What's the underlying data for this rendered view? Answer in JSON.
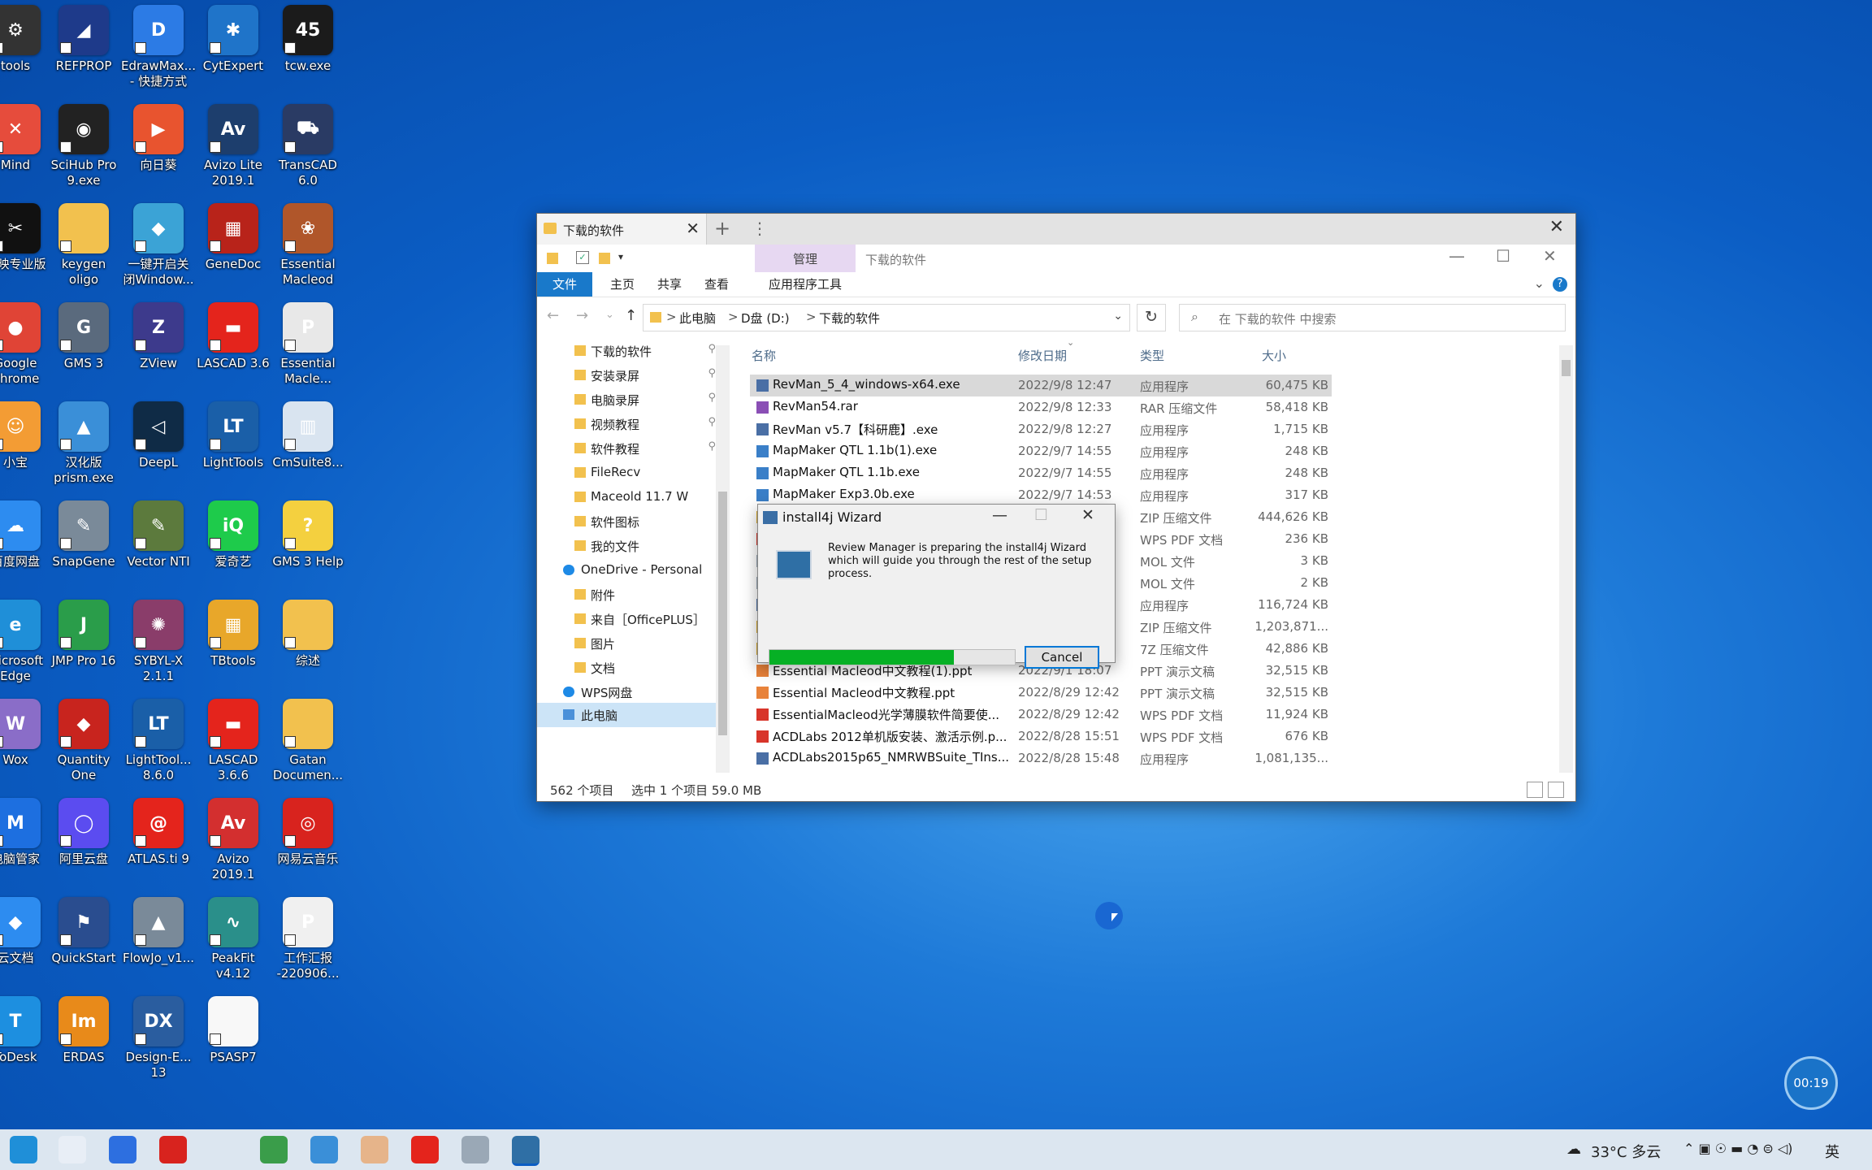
{
  "desktop": {
    "icons": [
      {
        "label": "tools",
        "col": 0,
        "row": 0,
        "color": "#333333",
        "glyph": "⚙"
      },
      {
        "label": "REFPROP",
        "col": 1,
        "row": 0,
        "color": "#1e3a8a",
        "glyph": "◢"
      },
      {
        "label": "EdrawMax...\n- 快捷方式",
        "col": 2,
        "row": 0,
        "color": "#2c7be5",
        "glyph": "D"
      },
      {
        "label": "CytExpert",
        "col": 3,
        "row": 0,
        "color": "#1f74c9",
        "glyph": "✱"
      },
      {
        "label": "tcw.exe",
        "col": 4,
        "row": 0,
        "color": "#1b1b1b",
        "glyph": "45"
      },
      {
        "label": "Mind",
        "col": 0,
        "row": 1,
        "color": "#e64c3c",
        "glyph": "✕"
      },
      {
        "label": "SciHub Pro\n9.exe",
        "col": 1,
        "row": 1,
        "color": "#222222",
        "glyph": "◉"
      },
      {
        "label": "向日葵",
        "col": 2,
        "row": 1,
        "color": "#e8542f",
        "glyph": "▶"
      },
      {
        "label": "Avizo Lite\n2019.1",
        "col": 3,
        "row": 1,
        "color": "#1d3e6d",
        "glyph": "Av"
      },
      {
        "label": "TransCAD\n6.0",
        "col": 4,
        "row": 1,
        "color": "#2a3b64",
        "glyph": "⛟"
      },
      {
        "label": "剪映专业版",
        "col": 0,
        "row": 2,
        "color": "#111111",
        "glyph": "✂"
      },
      {
        "label": "keygen\noligo",
        "col": 1,
        "row": 2,
        "color": "#f2c14e",
        "glyph": ""
      },
      {
        "label": "一键开启关\n闭Window...",
        "col": 2,
        "row": 2,
        "color": "#3ba3d6",
        "glyph": "◆"
      },
      {
        "label": "GeneDoc",
        "col": 3,
        "row": 2,
        "color": "#b8231a",
        "glyph": "▦"
      },
      {
        "label": "Essential\nMacleod",
        "col": 4,
        "row": 2,
        "color": "#b0562a",
        "glyph": "❀"
      },
      {
        "label": "Google\nChrome",
        "col": 0,
        "row": 3,
        "color": "#e04436",
        "glyph": "●"
      },
      {
        "label": "GMS 3",
        "col": 1,
        "row": 3,
        "color": "#5a6a7d",
        "glyph": "G"
      },
      {
        "label": "ZView",
        "col": 2,
        "row": 3,
        "color": "#3d3a8c",
        "glyph": "Z"
      },
      {
        "label": "LASCAD 3.6",
        "col": 3,
        "row": 3,
        "color": "#e4241c",
        "glyph": "▬"
      },
      {
        "label": "Essential\nMacle...",
        "col": 4,
        "row": 3,
        "color": "#e8e8e8",
        "glyph": "P"
      },
      {
        "label": "小宝",
        "col": 0,
        "row": 4,
        "color": "#f39c34",
        "glyph": "☺"
      },
      {
        "label": "汉化版\nprism.exe",
        "col": 1,
        "row": 4,
        "color": "#3a8fd8",
        "glyph": "▲"
      },
      {
        "label": "DeepL",
        "col": 2,
        "row": 4,
        "color": "#0f2b46",
        "glyph": "◁"
      },
      {
        "label": "LightTools",
        "col": 3,
        "row": 4,
        "color": "#1a5fa8",
        "glyph": "LT"
      },
      {
        "label": "CmSuite8...",
        "col": 4,
        "row": 4,
        "color": "#d9e4f0",
        "glyph": "▥"
      },
      {
        "label": "百度网盘",
        "col": 0,
        "row": 5,
        "color": "#2d8cf0",
        "glyph": "☁"
      },
      {
        "label": "SnapGene",
        "col": 1,
        "row": 5,
        "color": "#7a8a99",
        "glyph": "✎"
      },
      {
        "label": "Vector NTI",
        "col": 2,
        "row": 5,
        "color": "#5c7a3d",
        "glyph": "✎"
      },
      {
        "label": "爱奇艺",
        "col": 3,
        "row": 5,
        "color": "#1ecb4b",
        "glyph": "iQ"
      },
      {
        "label": "GMS 3 Help",
        "col": 4,
        "row": 5,
        "color": "#f4d03f",
        "glyph": "?"
      },
      {
        "label": "Microsoft\nEdge",
        "col": 0,
        "row": 6,
        "color": "#1f8fd8",
        "glyph": "e"
      },
      {
        "label": "JMP Pro 16",
        "col": 1,
        "row": 6,
        "color": "#2a9d4a",
        "glyph": "J"
      },
      {
        "label": "SYBYL-X\n2.1.1",
        "col": 2,
        "row": 6,
        "color": "#8a3d6a",
        "glyph": "✺"
      },
      {
        "label": "TBtools",
        "col": 3,
        "row": 6,
        "color": "#e8a72a",
        "glyph": "▦"
      },
      {
        "label": "综述",
        "col": 4,
        "row": 6,
        "color": "#f2c14e",
        "glyph": ""
      },
      {
        "label": "Wox",
        "col": 0,
        "row": 7,
        "color": "#8a6dc8",
        "glyph": "W"
      },
      {
        "label": "Quantity\nOne",
        "col": 1,
        "row": 7,
        "color": "#c8241e",
        "glyph": "◆"
      },
      {
        "label": "LightTool...\n8.6.0",
        "col": 2,
        "row": 7,
        "color": "#1a5fa8",
        "glyph": "LT"
      },
      {
        "label": "LASCAD\n3.6.6",
        "col": 3,
        "row": 7,
        "color": "#e4241c",
        "glyph": "▬"
      },
      {
        "label": "Gatan\nDocumen...",
        "col": 4,
        "row": 7,
        "color": "#f2c14e",
        "glyph": ""
      },
      {
        "label": "电脑管家",
        "col": 0,
        "row": 8,
        "color": "#1d6fe0",
        "glyph": "M"
      },
      {
        "label": "阿里云盘",
        "col": 1,
        "row": 8,
        "color": "#5b4cf0",
        "glyph": "◯"
      },
      {
        "label": "ATLAS.ti 9",
        "col": 2,
        "row": 8,
        "color": "#e4241c",
        "glyph": "@"
      },
      {
        "label": "Avizo\n2019.1",
        "col": 3,
        "row": 8,
        "color": "#d32f2f",
        "glyph": "Av"
      },
      {
        "label": "网易云音乐",
        "col": 4,
        "row": 8,
        "color": "#d8231e",
        "glyph": "◎"
      },
      {
        "label": "云文档",
        "col": 0,
        "row": 9,
        "color": "#2d8cf0",
        "glyph": "◆"
      },
      {
        "label": "QuickStart",
        "col": 1,
        "row": 9,
        "color": "#2a4d8f",
        "glyph": "⚑"
      },
      {
        "label": "FlowJo_v1...",
        "col": 2,
        "row": 9,
        "color": "#7a8a99",
        "glyph": "▲"
      },
      {
        "label": "PeakFit\nv4.12",
        "col": 3,
        "row": 9,
        "color": "#2a8f8a",
        "glyph": "∿"
      },
      {
        "label": "工作汇报\n-220906...",
        "col": 4,
        "row": 9,
        "color": "#f0f0f0",
        "glyph": "P"
      },
      {
        "label": "ToDesk",
        "col": 0,
        "row": 10,
        "color": "#1d8fe0",
        "glyph": "T"
      },
      {
        "label": "ERDAS",
        "col": 1,
        "row": 10,
        "color": "#e88a1a",
        "glyph": "Im"
      },
      {
        "label": "Design-E...\n13",
        "col": 2,
        "row": 10,
        "color": "#2a5d9f",
        "glyph": "DX"
      },
      {
        "label": "PSASP7",
        "col": 3,
        "row": 10,
        "color": "#f8f8f8",
        "glyph": ""
      }
    ]
  },
  "explorer": {
    "tab_title": "下载的软件",
    "tab_close": "✕",
    "tab_add": "+",
    "tab_more": "⋮",
    "window_close": "✕",
    "manage_label": "管理",
    "title_text": "下载的软件",
    "wc_min": "—",
    "wc_max": "☐",
    "wc_close": "✕",
    "ribbon": {
      "file": "文件",
      "home": "主页",
      "share": "共享",
      "view": "查看",
      "apptools": "应用程序工具",
      "help": "?",
      "collapse": "⌄"
    },
    "nav": {
      "back": "←",
      "forward": "→",
      "recent": "⌄",
      "up": "↑"
    },
    "address": {
      "crumb1": "此电脑",
      "crumb2": "D盘 (D:)",
      "crumb3": "下载的软件",
      "sep": ">",
      "dropdown": "⌄",
      "refresh": "↻"
    },
    "search_placeholder": "在 下载的软件 中搜索",
    "search_icon": "⌕",
    "navpane": [
      {
        "label": "下载的软件",
        "pinned": true,
        "type": "folder",
        "indent": 1
      },
      {
        "label": "安装录屏",
        "pinned": true,
        "type": "folder",
        "indent": 1
      },
      {
        "label": "电脑录屏",
        "pinned": true,
        "type": "folder",
        "indent": 1
      },
      {
        "label": "视频教程",
        "pinned": true,
        "type": "folder",
        "indent": 1
      },
      {
        "label": "软件教程",
        "pinned": true,
        "type": "folder",
        "indent": 1
      },
      {
        "label": "FileRecv",
        "pinned": false,
        "type": "folder",
        "indent": 1
      },
      {
        "label": "Maceold 11.7 W",
        "pinned": false,
        "type": "folder",
        "indent": 1
      },
      {
        "label": "软件图标",
        "pinned": false,
        "type": "folder",
        "indent": 1
      },
      {
        "label": "我的文件",
        "pinned": false,
        "type": "folder",
        "indent": 1
      },
      {
        "label": "OneDrive - Personal",
        "pinned": false,
        "type": "cloud",
        "indent": 0
      },
      {
        "label": "附件",
        "pinned": false,
        "type": "folder",
        "indent": 1
      },
      {
        "label": "来自［OfficePLUS］",
        "pinned": false,
        "type": "folder",
        "indent": 1
      },
      {
        "label": "图片",
        "pinned": false,
        "type": "folder",
        "indent": 1
      },
      {
        "label": "文档",
        "pinned": false,
        "type": "folder",
        "indent": 1
      },
      {
        "label": "WPS网盘",
        "pinned": false,
        "type": "cloud",
        "indent": 0
      },
      {
        "label": "此电脑",
        "pinned": false,
        "type": "pc",
        "indent": 0
      }
    ],
    "columns": {
      "name": "名称",
      "date": "修改日期",
      "type": "类型",
      "size": "大小",
      "sort_indicator": "⌄"
    },
    "files": [
      {
        "name": "RevMan_5_4_windows-x64.exe",
        "date": "2022/9/8 12:47",
        "type": "应用程序",
        "size": "60,475 KB",
        "icon": "exe",
        "selected": true
      },
      {
        "name": "RevMan54.rar",
        "date": "2022/9/8 12:33",
        "type": "RAR 压缩文件",
        "size": "58,418 KB",
        "icon": "rar",
        "selected": false
      },
      {
        "name": "RevMan v5.7【科研鹿】.exe",
        "date": "2022/9/8 12:27",
        "type": "应用程序",
        "size": "1,715 KB",
        "icon": "exe",
        "selected": false
      },
      {
        "name": "MapMaker QTL 1.1b(1).exe",
        "date": "2022/9/7 14:55",
        "type": "应用程序",
        "size": "248 KB",
        "icon": "app",
        "selected": false
      },
      {
        "name": "MapMaker QTL 1.1b.exe",
        "date": "2022/9/7 14:55",
        "type": "应用程序",
        "size": "248 KB",
        "icon": "app",
        "selected": false
      },
      {
        "name": "MapMaker Exp3.0b.exe",
        "date": "2022/9/7 14:53",
        "type": "应用程序",
        "size": "317 KB",
        "icon": "app",
        "selected": false
      },
      {
        "name": "",
        "date": "",
        "type": "ZIP 压缩文件",
        "size": "444,626 KB",
        "icon": "zip",
        "selected": false
      },
      {
        "name": "",
        "date": "",
        "type": "WPS PDF 文档",
        "size": "236 KB",
        "icon": "pdf",
        "selected": false
      },
      {
        "name": "",
        "date": "",
        "type": "MOL 文件",
        "size": "3 KB",
        "icon": "file",
        "selected": false
      },
      {
        "name": "",
        "date": "",
        "type": "MOL 文件",
        "size": "2 KB",
        "icon": "file",
        "selected": false
      },
      {
        "name": "",
        "date": "",
        "type": "应用程序",
        "size": "116,724 KB",
        "icon": "exe",
        "selected": false
      },
      {
        "name": "",
        "date": "",
        "type": "ZIP 压缩文件",
        "size": "1,203,871...",
        "icon": "zip",
        "selected": false
      },
      {
        "name": "",
        "date": "",
        "type": "7Z 压缩文件",
        "size": "42,886 KB",
        "icon": "zip",
        "selected": false
      },
      {
        "name": "Essential Macleod中文教程(1).ppt",
        "date": "2022/9/1 18:07",
        "type": "PPT 演示文稿",
        "size": "32,515 KB",
        "icon": "ppt",
        "selected": false
      },
      {
        "name": "Essential Macleod中文教程.ppt",
        "date": "2022/8/29 12:42",
        "type": "PPT 演示文稿",
        "size": "32,515 KB",
        "icon": "ppt",
        "selected": false
      },
      {
        "name": "EssentialMacleod光学薄膜软件简要使...",
        "date": "2022/8/29 12:42",
        "type": "WPS PDF 文档",
        "size": "11,924 KB",
        "icon": "pdf",
        "selected": false
      },
      {
        "name": "ACDLabs 2012单机版安装、激活示例.p...",
        "date": "2022/8/28 15:51",
        "type": "WPS PDF 文档",
        "size": "676 KB",
        "icon": "pdf",
        "selected": false
      },
      {
        "name": "ACDLabs2015p65_NMRWBSuite_TIns...",
        "date": "2022/8/28 15:48",
        "type": "应用程序",
        "size": "1,081,135...",
        "icon": "exe",
        "selected": false
      }
    ],
    "status": {
      "count": "562 个项目",
      "selected": "选中 1 个项目  59.0 MB"
    }
  },
  "dialog": {
    "title": "install4j Wizard",
    "min": "—",
    "max": "☐",
    "close": "✕",
    "message": "Review Manager is preparing the install4j Wizard which will guide you through the rest of the setup process.",
    "progress": 0.75,
    "cancel": "Cancel"
  },
  "timer": "00:19",
  "taskbar": {
    "apps": [
      {
        "name": "edge-icon",
        "color": "#1f8fd8"
      },
      {
        "name": "paint-icon",
        "color": "#e8eef6"
      },
      {
        "name": "box-icon",
        "color": "#2d6fe0"
      },
      {
        "name": "wps-icon",
        "color": "#d8231e"
      },
      {
        "name": "cd-icon",
        "color": "#3a9d4a"
      },
      {
        "name": "flower-icon",
        "color": "#3a8fd8"
      },
      {
        "name": "avatar-icon",
        "color": "#e6b48a"
      },
      {
        "name": "atlas-icon",
        "color": "#e4241c"
      },
      {
        "name": "bin-icon",
        "color": "#9aa8b6"
      },
      {
        "name": "installer-icon",
        "color": "#2f6fa5"
      }
    ],
    "weather": "33°C 多云",
    "ime": "英",
    "tray_glyphs": "⌃  ▣  ☉  ▬  ◔  ⊜  ◁)"
  }
}
